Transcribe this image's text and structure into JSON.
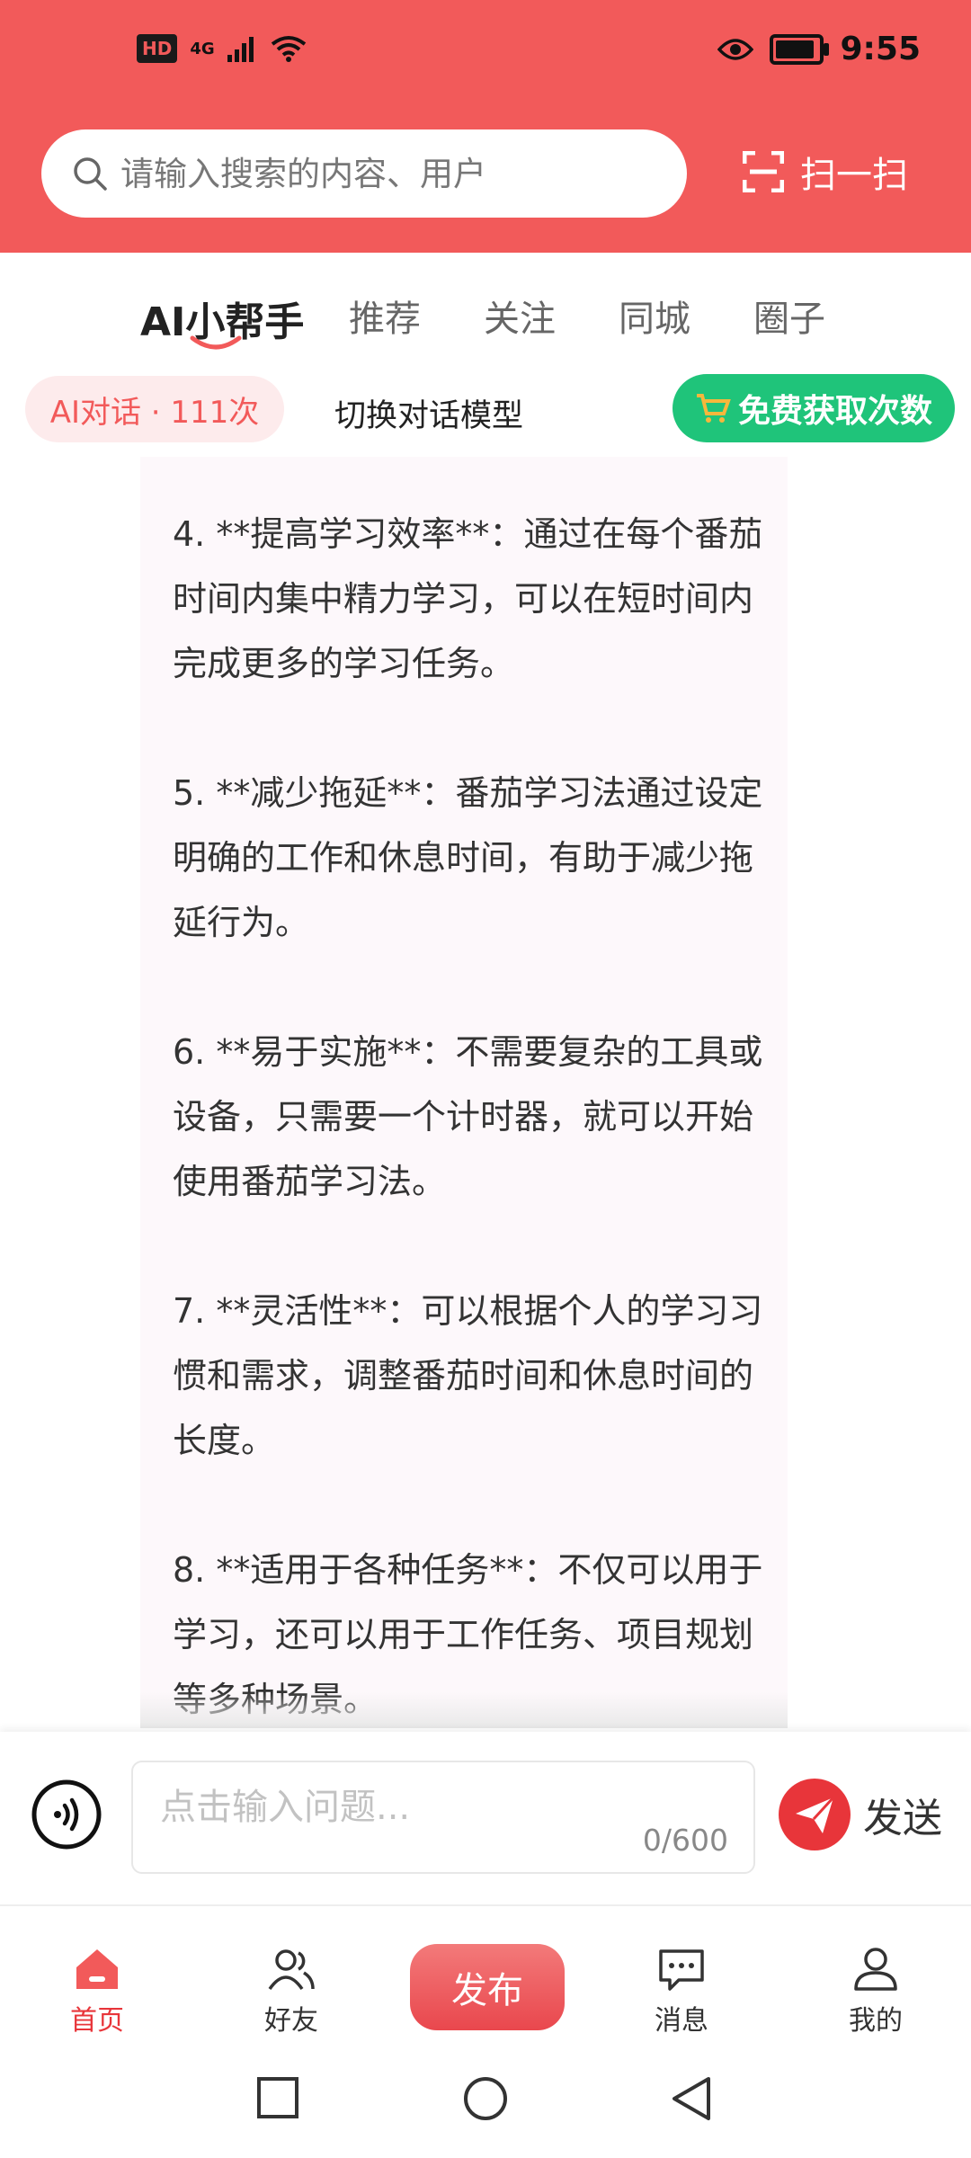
{
  "status_bar": {
    "hd": "HD",
    "network": "4G",
    "time": "9:55",
    "battery_level": 0.9
  },
  "header": {
    "search_placeholder": "请输入搜索的内容、用户",
    "scan_label": "扫一扫"
  },
  "tabs": [
    {
      "label": "AI小帮手",
      "active": true
    },
    {
      "label": "推荐",
      "active": false
    },
    {
      "label": "关注",
      "active": false
    },
    {
      "label": "同城",
      "active": false
    },
    {
      "label": "圈子",
      "active": false
    }
  ],
  "toolbar": {
    "ai_pill": "AI对话 · 111次",
    "switch_model": "切换对话模型",
    "free_button": "免费获取次数"
  },
  "chat": {
    "paragraphs": [
      "4. **提高学习效率**：通过在每个番茄时间内集中精力学习，可以在短时间内完成更多的学习任务。",
      "5. **减少拖延**：番茄学习法通过设定明确的工作和休息时间，有助于减少拖延行为。",
      "6. **易于实施**：不需要复杂的工具或设备，只需要一个计时器，就可以开始使用番茄学习法。",
      "7. **灵活性**：可以根据个人的学习习惯和需求，调整番茄时间和休息时间的长度。",
      "8. **适用于各种任务**：不仅可以用于学习，还可以用于工作任务、项目规划等多种场景。"
    ]
  },
  "input": {
    "placeholder": "点击输入问题...",
    "counter": "0/600",
    "send_label": "发送"
  },
  "bottom_nav": {
    "home": "首页",
    "friends": "好友",
    "publish": "发布",
    "messages": "消息",
    "mine": "我的"
  },
  "colors": {
    "brand_red": "#f25a5a",
    "accent_green": "#1fc47a",
    "send_red": "#e8353a"
  }
}
